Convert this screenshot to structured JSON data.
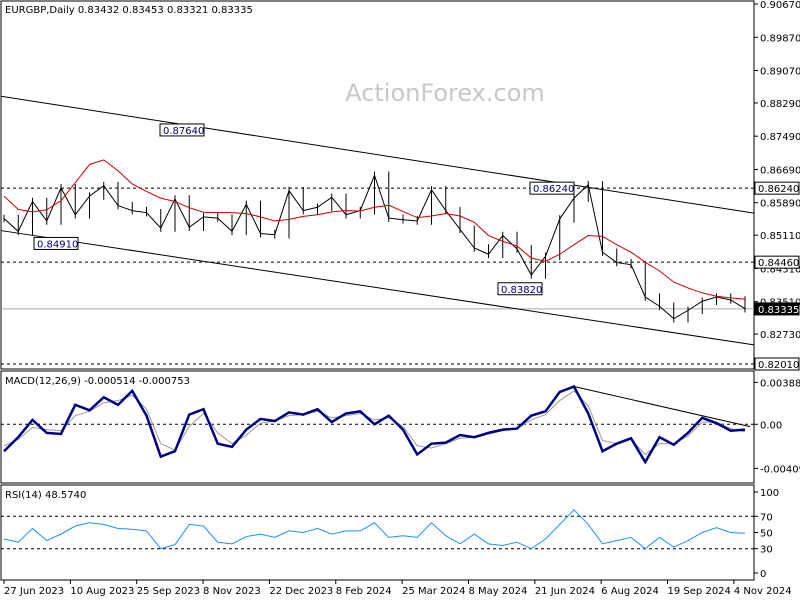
{
  "chart_data": [
    {
      "type": "line",
      "panel": "price",
      "title": "EURGBP,Daily  0.83432 0.83453 0.83321 0.83335",
      "watermark": "ActionForex.com",
      "ylim": [
        0.8201,
        0.9067
      ],
      "yticks": [
        "0.90670",
        "0.89870",
        "0.89070",
        "0.88290",
        "0.87490",
        "0.86690",
        "0.85890",
        "0.85110",
        "0.84310",
        "0.83510",
        "0.82730"
      ],
      "ytick_values": [
        0.9067,
        0.8987,
        0.8907,
        0.8829,
        0.8749,
        0.8669,
        0.8589,
        0.8511,
        0.8431,
        0.8351,
        0.8273
      ],
      "x": [
        "27 Jun 2023",
        "10 Aug 2023",
        "25 Sep 2023",
        "8 Nov 2023",
        "22 Dec 2023",
        "8 Feb 2024",
        "25 Mar 2024",
        "8 May 2024",
        "21 Jun 2024",
        "6 Aug 2024",
        "19 Sep 2024",
        "4 Nov 2024"
      ],
      "series": [
        {
          "role": "close",
          "values": [
            0.8551,
            0.852,
            0.8592,
            0.8545,
            0.8625,
            0.856,
            0.8605,
            0.863,
            0.8582,
            0.857,
            0.8565,
            0.8528,
            0.8598,
            0.853,
            0.8555,
            0.8552,
            0.852,
            0.8585,
            0.8515,
            0.8512,
            0.8618,
            0.857,
            0.8578,
            0.8602,
            0.856,
            0.857,
            0.8655,
            0.8552,
            0.8548,
            0.8545,
            0.862,
            0.857,
            0.8525,
            0.848,
            0.8465,
            0.851,
            0.8478,
            0.8415,
            0.846,
            0.855,
            0.86,
            0.8632,
            0.847,
            0.8445,
            0.844,
            0.8362,
            0.834,
            0.831,
            0.833,
            0.8352,
            0.8362,
            0.8355,
            0.8334
          ]
        },
        {
          "role": "moving-average",
          "values": [
            0.8605,
            0.8573,
            0.8567,
            0.8572,
            0.8594,
            0.8637,
            0.8681,
            0.8692,
            0.8666,
            0.8634,
            0.8616,
            0.86,
            0.8592,
            0.8577,
            0.8566,
            0.8565,
            0.8565,
            0.8563,
            0.8555,
            0.8545,
            0.8549,
            0.8556,
            0.856,
            0.8567,
            0.857,
            0.8569,
            0.8578,
            0.8583,
            0.8568,
            0.8553,
            0.8557,
            0.8563,
            0.8557,
            0.8542,
            0.851,
            0.8496,
            0.8485,
            0.8456,
            0.8448,
            0.8465,
            0.8488,
            0.851,
            0.8508,
            0.8488,
            0.847,
            0.8446,
            0.8425,
            0.8398,
            0.8384,
            0.8372,
            0.8364,
            0.836,
            0.8357
          ]
        }
      ],
      "levels": [
        {
          "label": "0.86240",
          "value": 0.8624,
          "dashed": true
        },
        {
          "label": "0.84460",
          "value": 0.8446,
          "dashed": true
        },
        {
          "label": "0.83335",
          "value": 0.83335,
          "dashed": false,
          "current": true
        },
        {
          "label": "0.82010",
          "value": 0.8201,
          "dashed": true
        }
      ],
      "annotations": [
        {
          "label": "0.87640",
          "value": 0.8764
        },
        {
          "label": "0.84910",
          "value": 0.8491
        },
        {
          "label": "0.86240",
          "value": 0.8624
        },
        {
          "label": "0.83820",
          "value": 0.8382
        }
      ],
      "trendlines": [
        {
          "from": {
            "x": "27 Jun 2023",
            "value": 0.8845
          },
          "to": {
            "x": "after 4 Nov 2024",
            "value": 0.8564
          }
        },
        {
          "from": {
            "x": "27 Jun 2023",
            "value": 0.8522
          },
          "to": {
            "x": "after 4 Nov 2024",
            "value": 0.8247
          }
        }
      ],
      "colors": {
        "close": "#000000",
        "moving-average": "#cc0000",
        "trendline": "#000000"
      }
    },
    {
      "type": "line",
      "panel": "macd",
      "title": "MACD(12,26,9) -0.000514 -0.000753",
      "ylim": [
        -0.0048,
        0.0042
      ],
      "yticks": [
        "0.003888",
        "0.00",
        "-0.004099"
      ],
      "ytick_values": [
        0.003888,
        0,
        -0.004099
      ],
      "series": [
        {
          "role": "macd",
          "values": [
            -0.0025,
            -0.0012,
            0.0004,
            -0.0008,
            -0.0009,
            0.0018,
            0.0013,
            0.0025,
            0.0018,
            0.0031,
            0.0008,
            -0.003,
            -0.0025,
            0.0009,
            0.0014,
            -0.0018,
            -0.0021,
            -0.0005,
            0.0005,
            0.0003,
            0.0011,
            0.0009,
            0.0014,
            0.0002,
            0.001,
            0.0012,
            0.0,
            0.0008,
            -0.0005,
            -0.0028,
            -0.0018,
            -0.0017,
            -0.001,
            -0.0012,
            -0.0008,
            -0.0005,
            -0.0004,
            0.0008,
            0.0012,
            0.003,
            0.0035,
            0.001,
            -0.0025,
            -0.0018,
            -0.0013,
            -0.0035,
            -0.0012,
            -0.0019,
            -0.0008,
            0.0006,
            0.0001,
            -0.0006,
            -0.0005
          ]
        },
        {
          "role": "signal",
          "values": [
            -0.002,
            -0.0014,
            -0.0003,
            -0.0005,
            -0.0006,
            0.0008,
            0.0012,
            0.002,
            0.0022,
            0.0027,
            0.0014,
            -0.0018,
            -0.0024,
            -0.0002,
            0.001,
            -0.0008,
            -0.0018,
            -0.001,
            0.0001,
            0.0003,
            0.0008,
            0.0009,
            0.0012,
            0.0006,
            0.0008,
            0.001,
            0.0004,
            0.0006,
            -0.0002,
            -0.002,
            -0.0022,
            -0.0018,
            -0.0013,
            -0.0012,
            -0.0009,
            -0.0006,
            -0.0004,
            0.0004,
            0.0009,
            0.0022,
            0.0031,
            0.0017,
            -0.0015,
            -0.0018,
            -0.0014,
            -0.0028,
            -0.0018,
            -0.0018,
            -0.0011,
            0.0002,
            0.0002,
            -0.0004,
            -0.0007
          ]
        }
      ],
      "colors": {
        "macd": "#000080",
        "signal": "#999999",
        "trendline": "#000000"
      }
    },
    {
      "type": "line",
      "panel": "rsi",
      "title": "RSI(14) 48.5740",
      "ylim": [
        0,
        100
      ],
      "yticks": [
        "100",
        "70",
        "50",
        "30",
        "0"
      ],
      "ytick_values": [
        100,
        70,
        50,
        30,
        0
      ],
      "series": [
        {
          "role": "rsi",
          "values": [
            42,
            38,
            55,
            40,
            48,
            58,
            62,
            60,
            55,
            54,
            52,
            30,
            35,
            60,
            58,
            38,
            36,
            45,
            48,
            44,
            52,
            50,
            55,
            48,
            52,
            52,
            62,
            44,
            46,
            44,
            62,
            46,
            36,
            48,
            36,
            34,
            38,
            30,
            42,
            60,
            78,
            60,
            36,
            40,
            44,
            30,
            44,
            32,
            40,
            50,
            56,
            50,
            49
          ]
        }
      ],
      "colors": {
        "rsi": "#1e90ff"
      }
    }
  ]
}
